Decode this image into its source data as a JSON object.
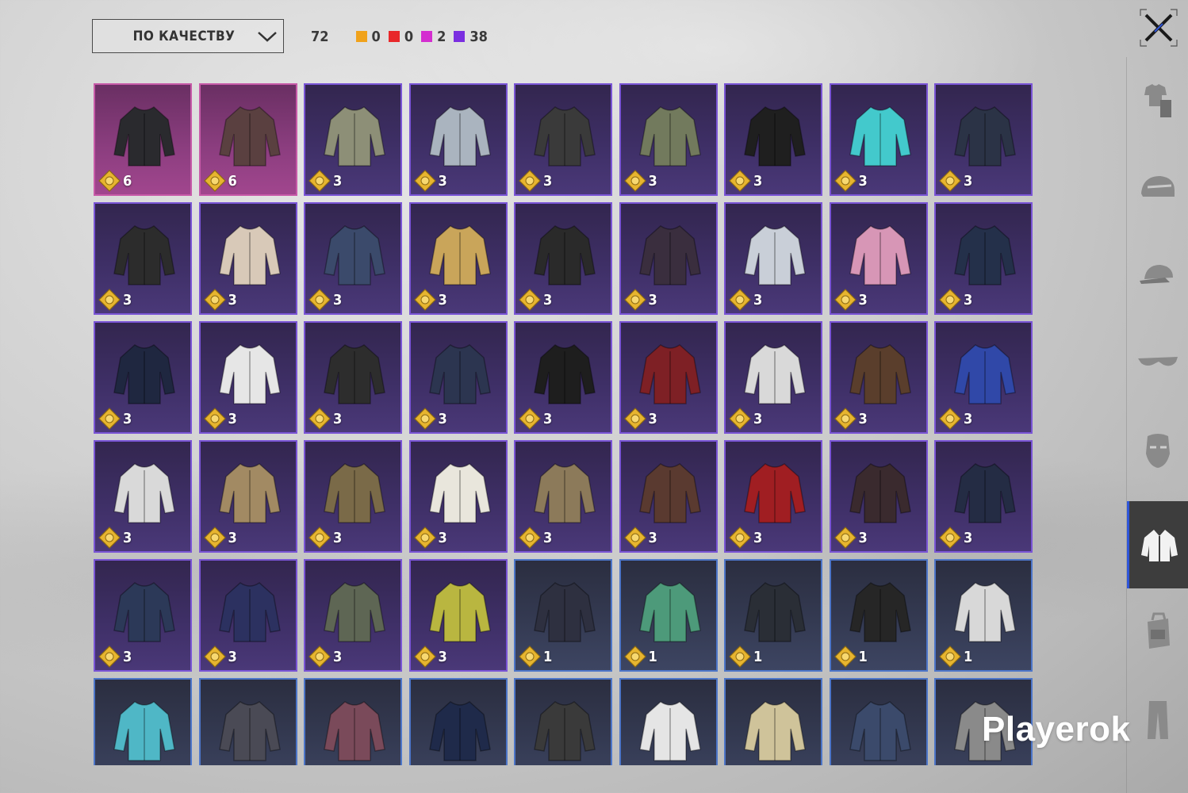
{
  "sort": {
    "label": "ПО КАЧЕСТВУ"
  },
  "counts": {
    "total": "72",
    "items": [
      {
        "color": "#f0a21b",
        "value": "0"
      },
      {
        "color": "#e8282a",
        "value": "0"
      },
      {
        "color": "#d42ed0",
        "value": "2"
      },
      {
        "color": "#7a2ee0",
        "value": "38"
      }
    ]
  },
  "colors": {
    "legendary": "#c75aa8",
    "epic": "#7a55d6",
    "rare": "#4d76c9",
    "active_tab": "#2f55d8"
  },
  "sidebar": {
    "items": [
      {
        "icon": "outfit-icon"
      },
      {
        "icon": "helmet-icon"
      },
      {
        "icon": "cap-icon"
      },
      {
        "icon": "sunglasses-icon"
      },
      {
        "icon": "mask-icon"
      },
      {
        "icon": "jacket-icon",
        "active": true
      },
      {
        "icon": "backpack-icon"
      },
      {
        "icon": "pants-icon"
      }
    ]
  },
  "watermark": "Playerok",
  "items": [
    {
      "rarity": "legendary",
      "color": "#2a2a2e",
      "qty": "6"
    },
    {
      "rarity": "legendary",
      "color": "#5a4040",
      "qty": "6"
    },
    {
      "rarity": "epic",
      "color": "#8d8f77",
      "qty": "3"
    },
    {
      "rarity": "epic",
      "color": "#aab4bf",
      "qty": "3"
    },
    {
      "rarity": "epic",
      "color": "#3a3a3a",
      "qty": "3"
    },
    {
      "rarity": "epic",
      "color": "#727a5d",
      "qty": "3"
    },
    {
      "rarity": "epic",
      "color": "#1f1f1f",
      "qty": "3"
    },
    {
      "rarity": "epic",
      "color": "#43c9cc",
      "qty": "3"
    },
    {
      "rarity": "epic",
      "color": "#2b3346",
      "qty": "3"
    },
    {
      "rarity": "epic",
      "color": "#2c2c2c",
      "qty": "3"
    },
    {
      "rarity": "epic",
      "color": "#d8c9b8",
      "qty": "3"
    },
    {
      "rarity": "epic",
      "color": "#3b4a6b",
      "qty": "3"
    },
    {
      "rarity": "epic",
      "color": "#c9a55a",
      "qty": "3"
    },
    {
      "rarity": "epic",
      "color": "#2a2a2a",
      "qty": "3"
    },
    {
      "rarity": "epic",
      "color": "#3a2e3e",
      "qty": "3"
    },
    {
      "rarity": "epic",
      "color": "#c9cfd8",
      "qty": "3"
    },
    {
      "rarity": "epic",
      "color": "#d796b6",
      "qty": "3"
    },
    {
      "rarity": "epic",
      "color": "#24304a",
      "qty": "3"
    },
    {
      "rarity": "epic",
      "color": "#1f2740",
      "qty": "3"
    },
    {
      "rarity": "epic",
      "color": "#e6e6e6",
      "qty": "3"
    },
    {
      "rarity": "epic",
      "color": "#2d2d2d",
      "qty": "3"
    },
    {
      "rarity": "epic",
      "color": "#2c3550",
      "qty": "3"
    },
    {
      "rarity": "epic",
      "color": "#1e1e1e",
      "qty": "3"
    },
    {
      "rarity": "epic",
      "color": "#7e2025",
      "qty": "3"
    },
    {
      "rarity": "epic",
      "color": "#d9d9d9",
      "qty": "3"
    },
    {
      "rarity": "epic",
      "color": "#5a3e2c",
      "qty": "3"
    },
    {
      "rarity": "epic",
      "color": "#3048a8",
      "qty": "3"
    },
    {
      "rarity": "epic",
      "color": "#d9d9d9",
      "qty": "3"
    },
    {
      "rarity": "epic",
      "color": "#a28a63",
      "qty": "3"
    },
    {
      "rarity": "epic",
      "color": "#7a6a48",
      "qty": "3"
    },
    {
      "rarity": "epic",
      "color": "#e9e6dc",
      "qty": "3"
    },
    {
      "rarity": "epic",
      "color": "#8c7a5a",
      "qty": "3"
    },
    {
      "rarity": "epic",
      "color": "#5a3a30",
      "qty": "3"
    },
    {
      "rarity": "epic",
      "color": "#a01e22",
      "qty": "3"
    },
    {
      "rarity": "epic",
      "color": "#3a2a2e",
      "qty": "3"
    },
    {
      "rarity": "epic",
      "color": "#242c44",
      "qty": "3"
    },
    {
      "rarity": "epic",
      "color": "#2c3958",
      "qty": "3"
    },
    {
      "rarity": "epic",
      "color": "#2c3160",
      "qty": "3"
    },
    {
      "rarity": "epic",
      "color": "#5e6654",
      "qty": "3"
    },
    {
      "rarity": "epic",
      "color": "#b9b640",
      "qty": "3"
    },
    {
      "rarity": "rare",
      "color": "#2e3040",
      "qty": "1"
    },
    {
      "rarity": "rare",
      "color": "#4d9a7a",
      "qty": "1"
    },
    {
      "rarity": "rare",
      "color": "#2a2e36",
      "qty": "1"
    },
    {
      "rarity": "rare",
      "color": "#262626",
      "qty": "1"
    },
    {
      "rarity": "rare",
      "color": "#d8d8d8",
      "qty": "1"
    },
    {
      "rarity": "rare",
      "color": "#4fb7c6",
      "qty": ""
    },
    {
      "rarity": "rare",
      "color": "#4a4a55",
      "qty": ""
    },
    {
      "rarity": "rare",
      "color": "#7a4a5a",
      "qty": ""
    },
    {
      "rarity": "rare",
      "color": "#1f2a4a",
      "qty": ""
    },
    {
      "rarity": "rare",
      "color": "#3a3a3a",
      "qty": ""
    },
    {
      "rarity": "rare",
      "color": "#e5e5e5",
      "qty": ""
    },
    {
      "rarity": "rare",
      "color": "#cfc39a",
      "qty": ""
    },
    {
      "rarity": "rare",
      "color": "#3b4a6b",
      "qty": ""
    },
    {
      "rarity": "rare",
      "color": "#8a8a8a",
      "qty": ""
    }
  ]
}
